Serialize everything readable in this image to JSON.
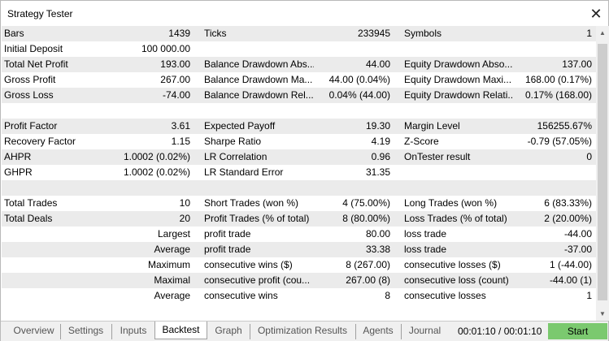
{
  "window": {
    "title": "Strategy Tester"
  },
  "rows": [
    {
      "shade": true,
      "c1": "Bars",
      "v1": "1439",
      "c2": "Ticks",
      "v2": "233945",
      "c3": "Symbols",
      "v3": "1"
    },
    {
      "shade": false,
      "c1": "Initial Deposit",
      "v1": "100 000.00",
      "c2": "",
      "v2": "",
      "c3": "",
      "v3": ""
    },
    {
      "shade": true,
      "c1": "Total Net Profit",
      "v1": "193.00",
      "c2": "Balance Drawdown Abs...",
      "v2": "44.00",
      "c3": "Equity Drawdown Abso...",
      "v3": "137.00"
    },
    {
      "shade": false,
      "c1": "Gross Profit",
      "v1": "267.00",
      "c2": "Balance Drawdown Ma...",
      "v2": "44.00 (0.04%)",
      "c3": "Equity Drawdown Maxi...",
      "v3": "168.00 (0.17%)"
    },
    {
      "shade": true,
      "c1": "Gross Loss",
      "v1": "-74.00",
      "c2": "Balance Drawdown Rel...",
      "v2": "0.04% (44.00)",
      "c3": "Equity Drawdown Relati...",
      "v3": "0.17% (168.00)"
    },
    {
      "shade": false,
      "c1": "",
      "v1": "",
      "c2": "",
      "v2": "",
      "c3": "",
      "v3": ""
    },
    {
      "shade": true,
      "c1": "Profit Factor",
      "v1": "3.61",
      "c2": "Expected Payoff",
      "v2": "19.30",
      "c3": "Margin Level",
      "v3": "156255.67%"
    },
    {
      "shade": false,
      "c1": "Recovery Factor",
      "v1": "1.15",
      "c2": "Sharpe Ratio",
      "v2": "4.19",
      "c3": "Z-Score",
      "v3": "-0.79 (57.05%)"
    },
    {
      "shade": true,
      "c1": "AHPR",
      "v1": "1.0002 (0.02%)",
      "c2": "LR Correlation",
      "v2": "0.96",
      "c3": "OnTester result",
      "v3": "0"
    },
    {
      "shade": false,
      "c1": "GHPR",
      "v1": "1.0002 (0.02%)",
      "c2": "LR Standard Error",
      "v2": "31.35",
      "c3": "",
      "v3": ""
    },
    {
      "shade": true,
      "c1": "",
      "v1": "",
      "c2": "",
      "v2": "",
      "c3": "",
      "v3": ""
    },
    {
      "shade": false,
      "c1": "Total Trades",
      "v1": "10",
      "c2": "Short Trades (won %)",
      "v2": "4 (75.00%)",
      "c3": "Long Trades (won %)",
      "v3": "6 (83.33%)"
    },
    {
      "shade": true,
      "c1": "Total Deals",
      "v1": "20",
      "c2": "Profit Trades (% of total)",
      "v2": "8 (80.00%)",
      "c3": "Loss Trades (% of total)",
      "v3": "2 (20.00%)"
    },
    {
      "shade": false,
      "c1": "",
      "v1": "Largest",
      "c2": "profit trade",
      "v2": "80.00",
      "c3": "loss trade",
      "v3": "-44.00"
    },
    {
      "shade": true,
      "c1": "",
      "v1": "Average",
      "c2": "profit trade",
      "v2": "33.38",
      "c3": "loss trade",
      "v3": "-37.00"
    },
    {
      "shade": false,
      "c1": "",
      "v1": "Maximum",
      "c2": "consecutive wins ($)",
      "v2": "8 (267.00)",
      "c3": "consecutive losses ($)",
      "v3": "1 (-44.00)"
    },
    {
      "shade": true,
      "c1": "",
      "v1": "Maximal",
      "c2": "consecutive profit (cou...",
      "v2": "267.00 (8)",
      "c3": "consecutive loss (count)",
      "v3": "-44.00 (1)"
    },
    {
      "shade": false,
      "c1": "",
      "v1": "Average",
      "c2": "consecutive wins",
      "v2": "8",
      "c3": "consecutive losses",
      "v3": "1"
    }
  ],
  "tabs": [
    {
      "label": "Overview",
      "active": false
    },
    {
      "label": "Settings",
      "active": false
    },
    {
      "label": "Inputs",
      "active": false
    },
    {
      "label": "Backtest",
      "active": true
    },
    {
      "label": "Graph",
      "active": false
    },
    {
      "label": "Optimization Results",
      "active": false
    },
    {
      "label": "Agents",
      "active": false
    },
    {
      "label": "Journal",
      "active": false
    }
  ],
  "status": {
    "timer": "00:01:10 / 00:01:10",
    "start_label": "Start"
  },
  "colors": {
    "row_shade": "#ebebeb",
    "start_button": "#7bc96f"
  },
  "icons": {
    "close": "close-icon"
  }
}
